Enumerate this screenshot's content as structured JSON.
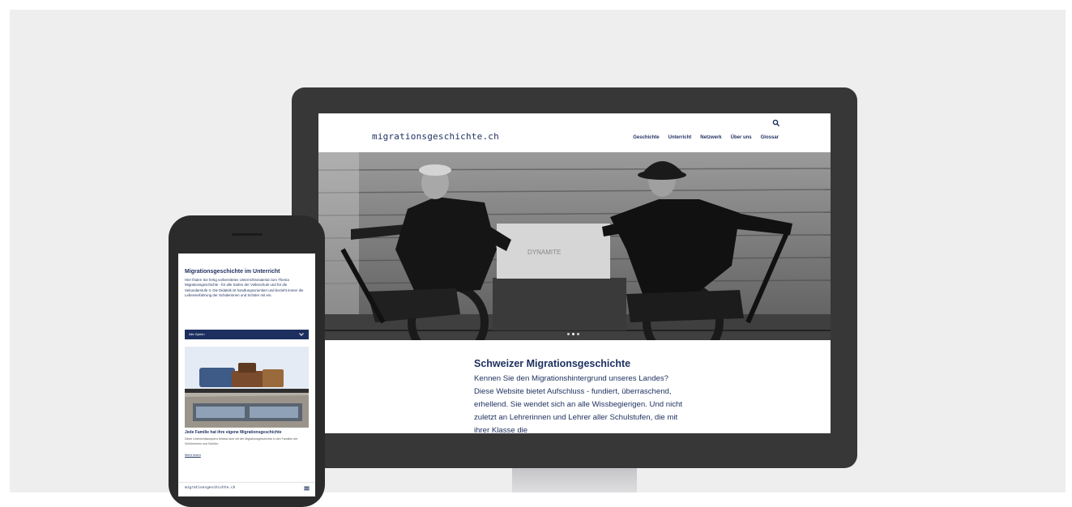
{
  "desktop": {
    "logo": "migrationsgeschichte.ch",
    "search_icon": "search-icon",
    "nav": [
      "Geschichte",
      "Unterricht",
      "Netzwerk",
      "Über uns",
      "Glossar"
    ],
    "hero_icon": "hero-photo-two-men-on-rail-handcar",
    "carousel": {
      "count": 3,
      "active": 1
    },
    "intro": {
      "title": "Schweizer Migrationsgeschichte",
      "text": "Kennen Sie den Migrationshintergrund unseres Landes? Diese Website bietet Aufschluss - fundiert, überraschend, erhellend. Sie wendet sich an alle Wissbegierigen. Und nicht zuletzt an Lehrerinnen und Lehrer aller Schulstufen, die mit ihrer Klasse die"
    }
  },
  "mobile": {
    "title": "Migrationsgeschichte im Unterricht",
    "text": "Hier finden Sie fertig vorbereitetes Unterrichtsmaterial zum Thema Migrationsgeschichte - für alle Stufen der Volksschule und für die Sekundarstufe II. Die Didaktik ist handlungsorientiert und bezieht immer die Lebenserfahrung der Schülerinnen und Schüler mit ein.",
    "select_value": "Alle Zyklen",
    "chevron_icon": "chevron-down-icon",
    "card_image_icon": "car-roof-luggage-photo",
    "card_title": "Jede Familie hat ihre eigene Migrationsgeschichte",
    "card_text": "Diese Unterrichtssequenz befasst sich mit der Migrationsgeschichte in den Familien der Schülerinnen und Schüler.",
    "more_link": "Mehr lesen",
    "footer_logo": "migrationsgeschichte.ch",
    "menu_icon": "hamburger-menu-icon"
  },
  "colors": {
    "backdrop": "#eeeeee",
    "device_frame": "#373737",
    "brand_navy": "#1c2f5e"
  }
}
